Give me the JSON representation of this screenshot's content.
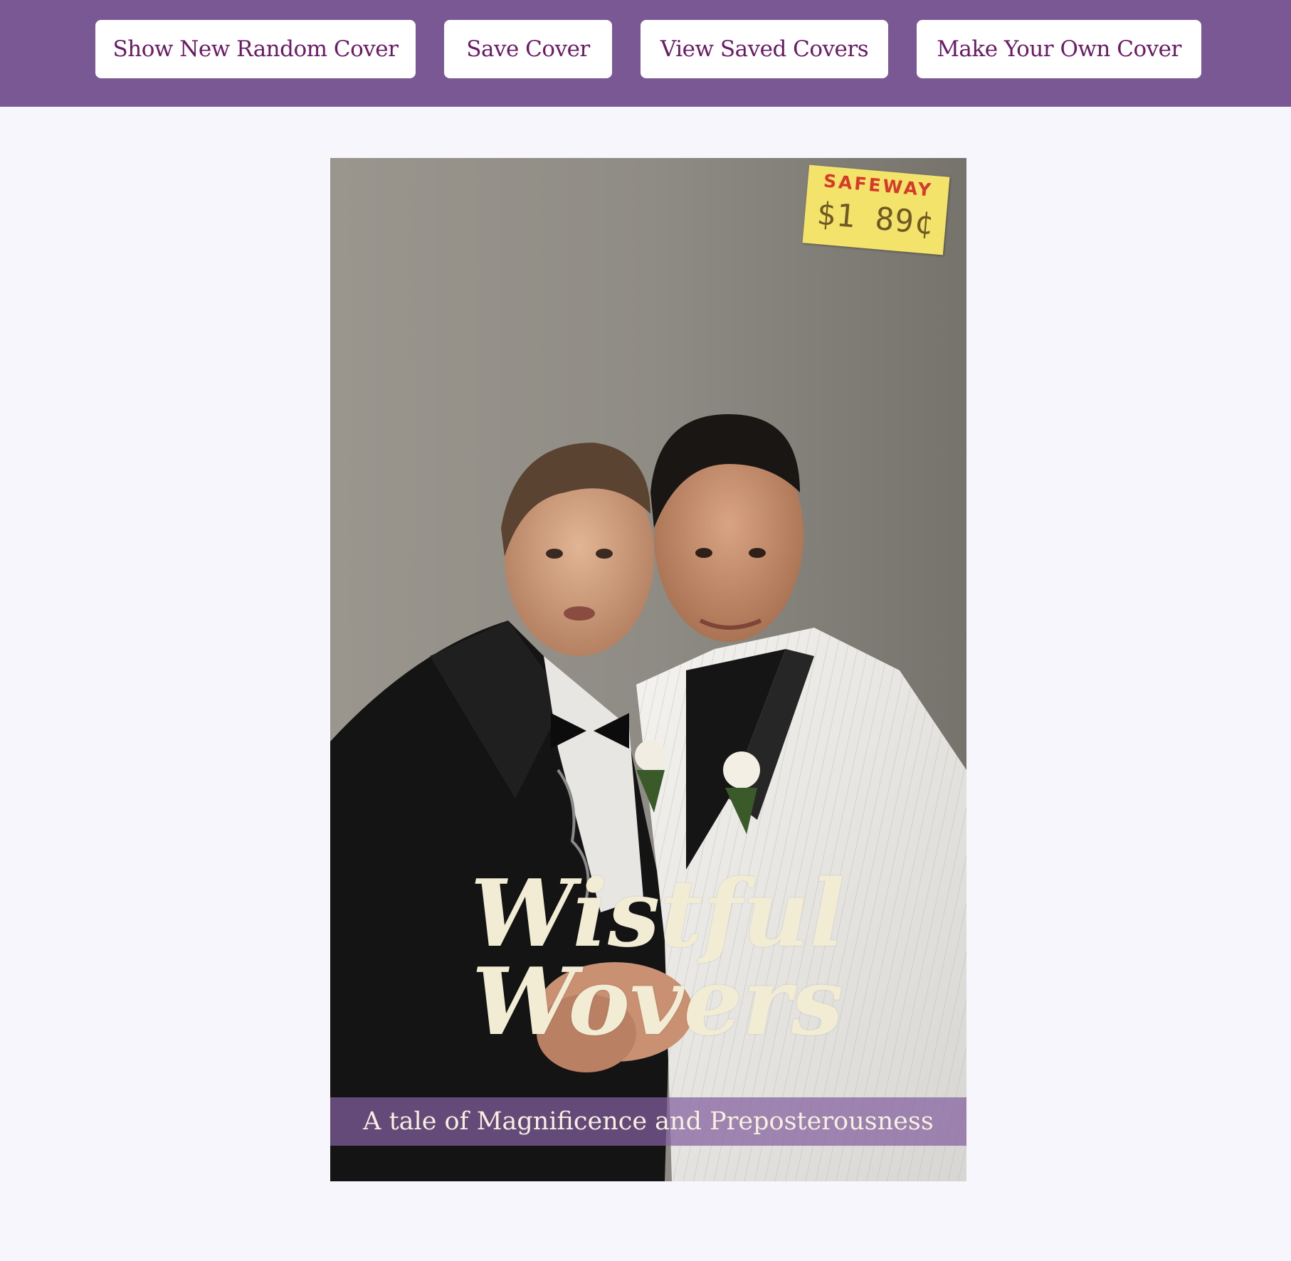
{
  "nav": {
    "random_label": "Show New Random Cover",
    "save_label": "Save Cover",
    "view_saved_label": "View Saved Covers",
    "make_own_label": "Make Your Own Cover"
  },
  "cover": {
    "image_description": "Two men in wedding tuxedos (one black, one white pinstripe) embracing with white rose boutonnieres, gray studio backdrop",
    "price_sticker": {
      "store": "SAFEWAY",
      "price": "$1 89¢"
    },
    "title": "Wistful Wovers",
    "tagline": "A tale of Magnificence and Preposterousness"
  },
  "colors": {
    "topbar": "#7a5894",
    "button_bg": "#ffffff",
    "button_text": "#6a1a66",
    "page_bg": "#f7f6fc",
    "title_text": "#f2ecd5",
    "tagline_band": "#8460a0"
  }
}
